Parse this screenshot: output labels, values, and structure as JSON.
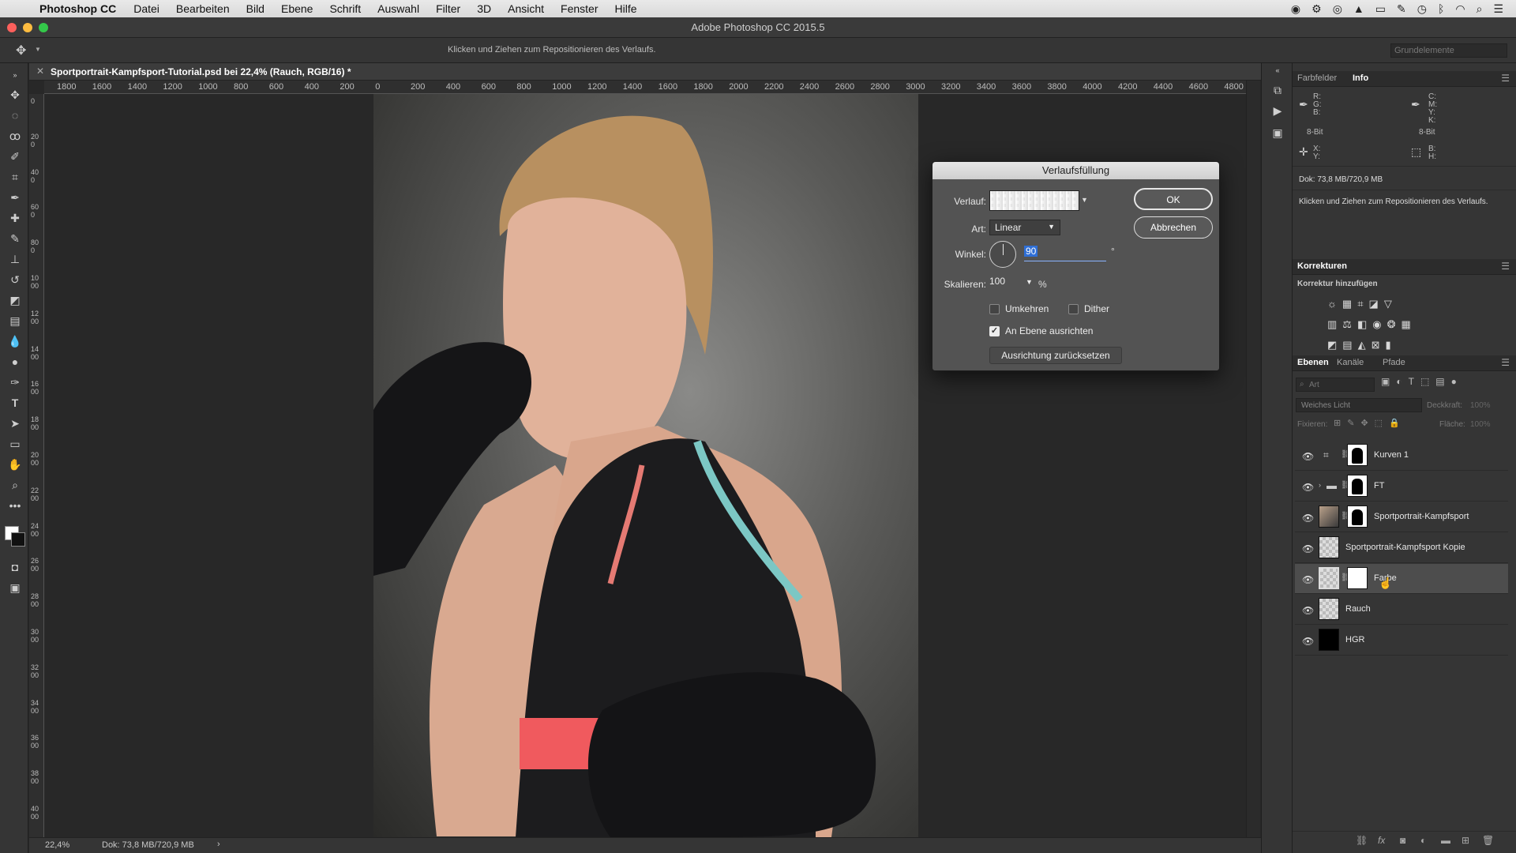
{
  "menubar": {
    "app_name": "Photoshop CC",
    "items": [
      "Datei",
      "Bearbeiten",
      "Bild",
      "Ebene",
      "Schrift",
      "Auswahl",
      "Filter",
      "3D",
      "Ansicht",
      "Fenster",
      "Hilfe"
    ]
  },
  "window": {
    "title": "Adobe Photoshop CC 2015.5"
  },
  "options_bar": {
    "hint": "Klicken und Ziehen zum Repositionieren des Verlaufs.",
    "workspace": "Grundelemente"
  },
  "document": {
    "tab_title": "Sportportrait-Kampfsport-Tutorial.psd bei 22,4% (Rauch, RGB/16) *"
  },
  "ruler": {
    "h_ticks": [
      "1800",
      "1600",
      "1400",
      "1200",
      "1000",
      "800",
      "600",
      "400",
      "200",
      "0",
      "200",
      "400",
      "600",
      "800",
      "1000",
      "1200",
      "1400",
      "1600",
      "1800",
      "2000",
      "2200",
      "2400",
      "2600",
      "2800",
      "3000",
      "3200",
      "3400",
      "3600",
      "3800",
      "4000",
      "4200",
      "4400",
      "4600",
      "4800"
    ]
  },
  "status": {
    "zoom": "22,4%",
    "doc_size": "Dok: 73,8 MB/720,9 MB",
    "arrow": "›"
  },
  "info_panel": {
    "tabs": [
      "Farbfelder",
      "Info"
    ],
    "rgb_labels": "R:\nG:\nB:",
    "cmyk_labels": "C:\nM:\nY:\nK:",
    "bit_left": "8-Bit",
    "bit_right": "8-Bit",
    "xy_labels": "X:\nY:",
    "bh_labels": "B:\nH:",
    "doc_size": "Dok: 73,8 MB/720,9 MB",
    "hint": "Klicken und Ziehen zum Repositionieren des Verlaufs."
  },
  "adjustments_panel": {
    "title": "Korrekturen",
    "subtitle": "Korrektur hinzufügen"
  },
  "layers_panel": {
    "tabs": [
      "Ebenen",
      "Kanäle",
      "Pfade"
    ],
    "filter_placeholder": "Art",
    "blend_mode": "Weiches Licht",
    "opacity_label": "Deckkraft:",
    "opacity_value": "100%",
    "lock_label": "Fixieren:",
    "fill_label": "Fläche:",
    "fill_value": "100%",
    "layers": [
      {
        "name": "Kurven 1"
      },
      {
        "name": "FT"
      },
      {
        "name": "Sportportrait-Kampfsport"
      },
      {
        "name": "Sportportrait-Kampfsport Kopie"
      },
      {
        "name": "Farbe"
      },
      {
        "name": "Rauch"
      },
      {
        "name": "HGR"
      }
    ]
  },
  "dialog": {
    "title": "Verlaufsfüllung",
    "gradient_label": "Verlauf:",
    "style_label": "Art:",
    "style_value": "Linear",
    "angle_label": "Winkel:",
    "angle_value": "90",
    "angle_unit": "°",
    "scale_label": "Skalieren:",
    "scale_value": "100",
    "scale_unit": "%",
    "reverse_label": "Umkehren",
    "dither_label": "Dither",
    "align_label": "An Ebene ausrichten",
    "align_checked": true,
    "reset_button": "Ausrichtung zurücksetzen",
    "ok_button": "OK",
    "cancel_button": "Abbrechen"
  },
  "colors": {
    "accent_blue": "#2f6fd6",
    "panel_bg": "#353535",
    "canvas_bg": "#282828"
  }
}
